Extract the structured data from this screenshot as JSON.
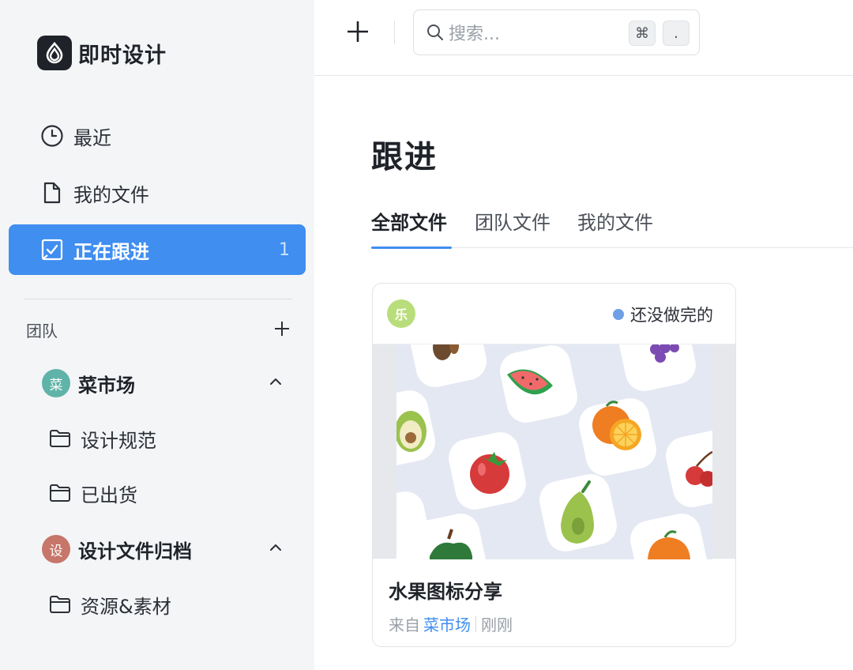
{
  "brand": {
    "name": "即时设计"
  },
  "nav": [
    {
      "label": "最近",
      "icon": "clock-icon"
    },
    {
      "label": "我的文件",
      "icon": "file-icon"
    },
    {
      "label": "正在跟进",
      "icon": "follow-icon",
      "count": "1",
      "active": true
    }
  ],
  "team": {
    "title": "团队",
    "groups": [
      {
        "avatar": "菜",
        "name": "菜市场",
        "avatar_color": "#5fb3a8",
        "folders": [
          "设计规范",
          "已出货"
        ]
      },
      {
        "avatar": "设",
        "name": "设计文件归档",
        "avatar_color": "#c7766a",
        "folders": [
          "资源&素材"
        ]
      }
    ]
  },
  "search": {
    "placeholder": "搜索...",
    "shortcut_keys": [
      "⌘",
      "."
    ]
  },
  "main": {
    "title": "跟进",
    "tabs": [
      {
        "label": "全部文件",
        "active": true
      },
      {
        "label": "团队文件",
        "active": false
      },
      {
        "label": "我的文件",
        "active": false
      }
    ]
  },
  "card": {
    "avatar": "乐",
    "status": "还没做完的",
    "status_color": "#6fa0e6",
    "title": "水果图标分享",
    "source_prefix": "来自",
    "source_team": "菜市场",
    "time": "刚刚"
  },
  "colors": {
    "accent": "#3f8ef0",
    "sidebar_bg": "#f4f5f7"
  }
}
